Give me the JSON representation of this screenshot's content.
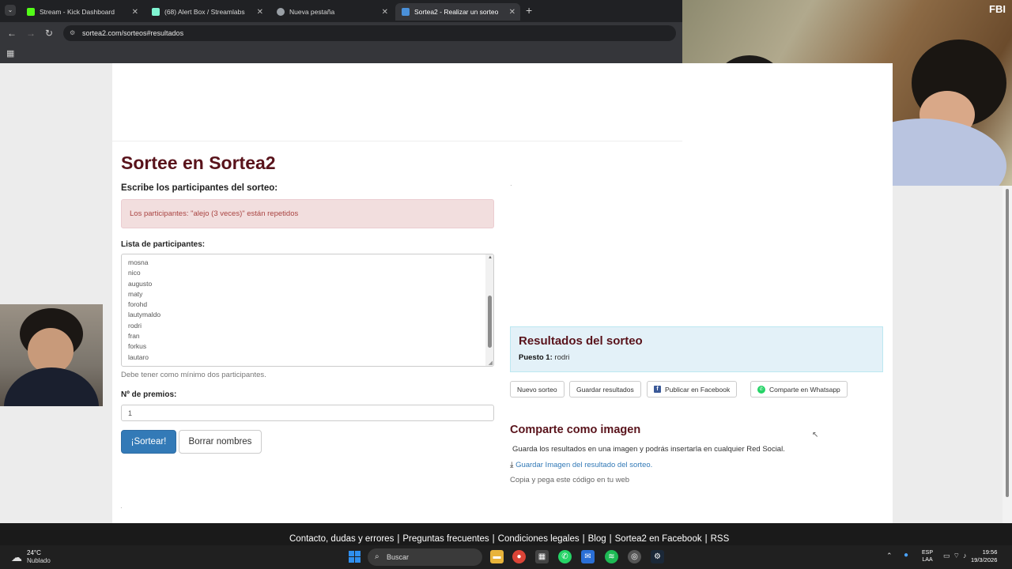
{
  "browser": {
    "tabs": [
      {
        "label": "Stream - Kick Dashboard",
        "active": false,
        "color": "#53fc18"
      },
      {
        "label": "(68) Alert Box / Streamlabs",
        "active": false,
        "color": "#80f5d2"
      },
      {
        "label": "Nueva pestaña",
        "active": false,
        "color": "#9aa0a6"
      },
      {
        "label": "Sortea2 - Realizar un sorteo",
        "active": true,
        "color": "#4a90d9"
      }
    ],
    "url": "sortea2.com/sorteos#resultados"
  },
  "form": {
    "title": "Sortee en Sortea2",
    "participants_heading": "Escribe los participantes del sorteo:",
    "alert": "Los participantes: \"alejo (3 veces)\" están repetidos",
    "list_label": "Lista de participantes:",
    "names": [
      "mosna",
      "nico",
      "augusto",
      "maty",
      "forohd",
      "lautymaldo",
      "rodri",
      "fran",
      "forkus",
      "lautaro"
    ],
    "help": "Debe tener como mínimo dos participantes.",
    "prizes_label": "Nº de premios:",
    "prizes_value": "1",
    "sortear_button": "¡Sortear!",
    "borrar_button": "Borrar nombres"
  },
  "results": {
    "title": "Resultados del sorteo",
    "position_label": "Puesto 1:",
    "winner": "rodri",
    "buttons": {
      "nuevo": "Nuevo sorteo",
      "guardar": "Guardar resultados",
      "facebook": "Publicar en Facebook",
      "whatsapp": "Comparte en Whatsapp"
    },
    "image_heading": "Comparte como imagen",
    "image_desc": "Guarda los resultados en una imagen y podrás insertarla en cualquier Red Social.",
    "save_link": "Guardar Imagen del resultado del sorteo.",
    "copy_text": "Copia y pega este código en tu web"
  },
  "footer": {
    "links": [
      "Contacto, dudas y errores",
      "Preguntas frecuentes",
      "Condiciones legales",
      "Blog",
      "Sortea2 en Facebook",
      "RSS"
    ]
  },
  "webcam": {
    "label": "FBI"
  },
  "taskbar": {
    "temperature": "24°C",
    "weather": "Nublado",
    "search_placeholder": "Buscar",
    "lang_line1": "ESP",
    "lang_line2": "LAA",
    "time": "19:56",
    "date": "19/3/2026"
  }
}
